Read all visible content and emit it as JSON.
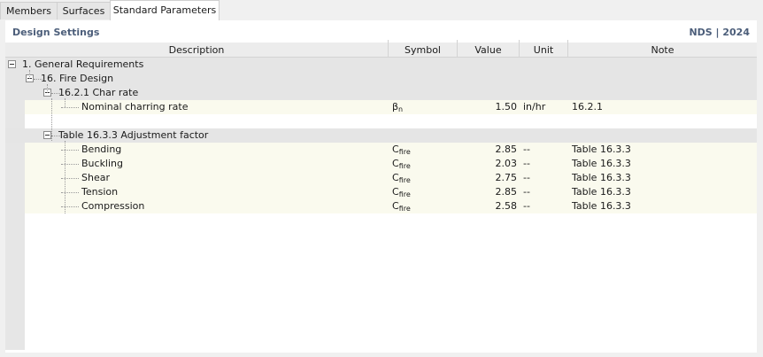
{
  "tabs": [
    {
      "label": "Members",
      "active": false
    },
    {
      "label": "Surfaces",
      "active": false
    },
    {
      "label": "Standard Parameters",
      "active": true
    }
  ],
  "panel": {
    "title": "Design Settings",
    "badge": "NDS | 2024"
  },
  "columns": {
    "description": "Description",
    "symbol": "Symbol",
    "value": "Value",
    "unit": "Unit",
    "note": "Note"
  },
  "tree": {
    "general": "1. General Requirements",
    "fire": "16. Fire Design",
    "char_rate": "16.2.1 Char rate",
    "charring": {
      "description": "Nominal charring rate",
      "symbol_base": "β",
      "symbol_sub": "n",
      "value": "1.50",
      "unit": "in/hr",
      "note": "16.2.1"
    },
    "adjustment": "Table 16.3.3 Adjustment factor",
    "factors": [
      {
        "description": "Bending",
        "symbol_base": "C",
        "symbol_sub": "fire",
        "value": "2.85",
        "unit": "--",
        "note": "Table 16.3.3"
      },
      {
        "description": "Buckling",
        "symbol_base": "C",
        "symbol_sub": "fire",
        "value": "2.03",
        "unit": "--",
        "note": "Table 16.3.3"
      },
      {
        "description": "Shear",
        "symbol_base": "C",
        "symbol_sub": "fire",
        "value": "2.75",
        "unit": "--",
        "note": "Table 16.3.3"
      },
      {
        "description": "Tension",
        "symbol_base": "C",
        "symbol_sub": "fire",
        "value": "2.85",
        "unit": "--",
        "note": "Table 16.3.3"
      },
      {
        "description": "Compression",
        "symbol_base": "C",
        "symbol_sub": "fire",
        "value": "2.58",
        "unit": "--",
        "note": "Table 16.3.3"
      }
    ]
  },
  "colors": {
    "header_text": "#4c5e7a",
    "group_row": "#e5e5e5",
    "data_row": "#fafaee"
  }
}
